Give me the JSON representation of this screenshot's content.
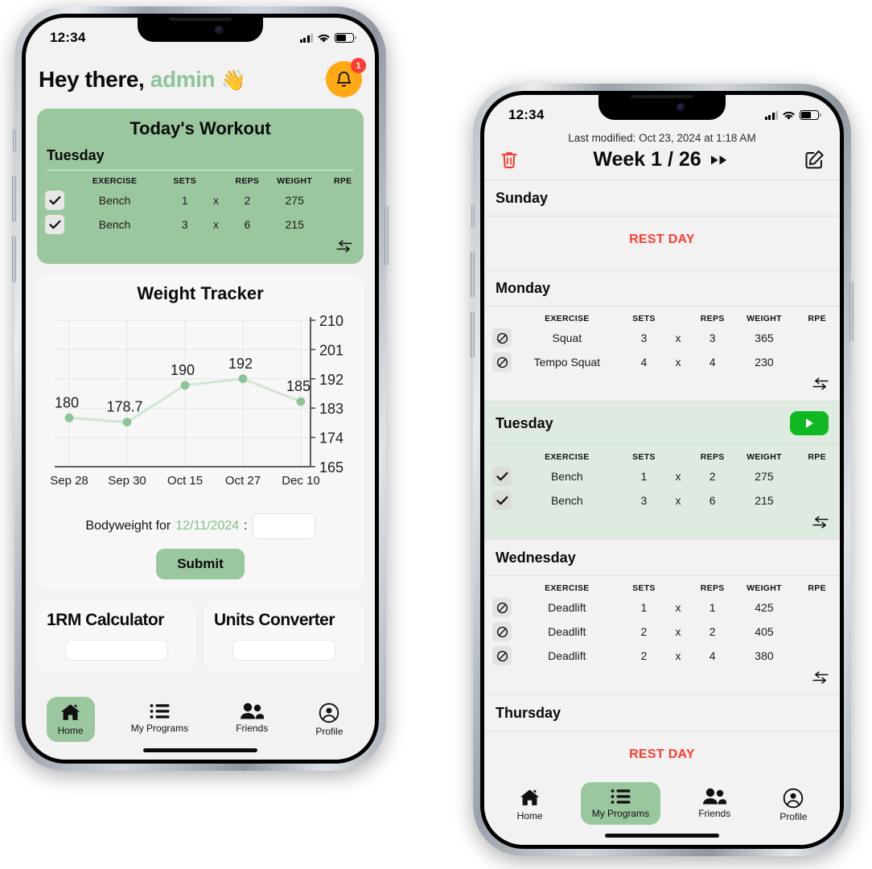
{
  "left_phone": {
    "status_bar": {
      "time": "12:34",
      "wifi_icon": "wifi-icon",
      "battery_icon": "battery-icon",
      "signal_icon": "cellular-signal-icon"
    },
    "header": {
      "greeting_prefix": "Hey there,",
      "username": "admin",
      "wave_emoji": "👋",
      "bell_icon": "notification-bell-icon",
      "notification_count": "1"
    },
    "today_card": {
      "title": "Today's Workout",
      "day": "Tuesday",
      "columns": [
        "EXERCISE",
        "SETS",
        "REPS",
        "WEIGHT",
        "RPE"
      ],
      "multiplier": "x",
      "rows": [
        {
          "checked": true,
          "exercise": "Bench",
          "sets": "1",
          "reps": "2",
          "weight": "275",
          "rpe": ""
        },
        {
          "checked": true,
          "exercise": "Bench",
          "sets": "3",
          "reps": "6",
          "weight": "215",
          "rpe": ""
        }
      ],
      "swap_icon": "swap-arrows-icon"
    },
    "tracker_card": {
      "title": "Weight Tracker",
      "bodyweight_label_prefix": "Bodyweight for",
      "bodyweight_date": "12/11/2024",
      "bodyweight_label_suffix": ":",
      "bodyweight_value": "",
      "bodyweight_placeholder": "",
      "submit_label": "Submit"
    },
    "tools": [
      {
        "title": "1RM Calculator"
      },
      {
        "title": "Units Converter"
      }
    ],
    "tabbar": {
      "active": "Home",
      "items": [
        {
          "label": "Home",
          "icon": "home-icon"
        },
        {
          "label": "My Programs",
          "icon": "list-icon"
        },
        {
          "label": "Friends",
          "icon": "people-icon"
        },
        {
          "label": "Profile",
          "icon": "person-circle-icon"
        }
      ]
    }
  },
  "right_phone": {
    "status_bar": {
      "time": "12:34",
      "wifi_icon": "wifi-icon",
      "battery_icon": "battery-icon",
      "signal_icon": "cellular-signal-icon"
    },
    "header": {
      "last_modified": "Last modified: Oct 23, 2024 at 1:18 AM",
      "title": "Week 1 / 26",
      "delete_icon": "trash-icon",
      "next_icon": "fast-forward-icon",
      "edit_icon": "edit-square-icon"
    },
    "columns": [
      "EXERCISE",
      "SETS",
      "REPS",
      "WEIGHT",
      "RPE"
    ],
    "multiplier": "x",
    "rest_day_label": "REST DAY",
    "swap_icon": "swap-arrows-icon",
    "days": [
      {
        "name": "Sunday",
        "rest": true,
        "highlight": false,
        "rows": []
      },
      {
        "name": "Monday",
        "rest": false,
        "highlight": false,
        "rows": [
          {
            "state": "blocked",
            "exercise": "Squat",
            "sets": "3",
            "reps": "3",
            "weight": "365",
            "rpe": ""
          },
          {
            "state": "blocked",
            "exercise": "Tempo Squat",
            "sets": "4",
            "reps": "4",
            "weight": "230",
            "rpe": ""
          }
        ]
      },
      {
        "name": "Tuesday",
        "rest": false,
        "highlight": true,
        "play_icon": "play-icon",
        "rows": [
          {
            "state": "checked",
            "exercise": "Bench",
            "sets": "1",
            "reps": "2",
            "weight": "275",
            "rpe": ""
          },
          {
            "state": "checked",
            "exercise": "Bench",
            "sets": "3",
            "reps": "6",
            "weight": "215",
            "rpe": ""
          }
        ]
      },
      {
        "name": "Wednesday",
        "rest": false,
        "highlight": false,
        "rows": [
          {
            "state": "blocked",
            "exercise": "Deadlift",
            "sets": "1",
            "reps": "1",
            "weight": "425",
            "rpe": ""
          },
          {
            "state": "blocked",
            "exercise": "Deadlift",
            "sets": "2",
            "reps": "2",
            "weight": "405",
            "rpe": ""
          },
          {
            "state": "blocked",
            "exercise": "Deadlift",
            "sets": "2",
            "reps": "4",
            "weight": "380",
            "rpe": ""
          }
        ]
      },
      {
        "name": "Thursday",
        "rest": true,
        "highlight": false,
        "rows": []
      }
    ],
    "tabbar": {
      "active": "My Programs",
      "items": [
        {
          "label": "Home",
          "icon": "home-icon"
        },
        {
          "label": "My Programs",
          "icon": "list-icon"
        },
        {
          "label": "Friends",
          "icon": "people-icon"
        },
        {
          "label": "Profile",
          "icon": "person-circle-icon"
        }
      ]
    }
  },
  "colors": {
    "brand_green": "#9BC79F",
    "light_green_section": "#DFEBE0",
    "username_green": "#8FC49A",
    "rest_day_red": "#FF3B30",
    "play_green": "#10B921",
    "bell_orange": "#FFA914",
    "chart_line": "#CFE6D2",
    "chart_point": "#8FC49A",
    "screen_bg": "#F2F2F2",
    "card_bg": "#F7F7F7"
  },
  "chart_data": {
    "type": "line",
    "title": "Weight Tracker",
    "x": [
      "Sep 28",
      "Sep 30",
      "Oct 15",
      "Oct 27",
      "Dec 10"
    ],
    "values": [
      180,
      178.7,
      190,
      192,
      185
    ],
    "point_labels": [
      "180",
      "178.7",
      "190",
      "192",
      "185"
    ],
    "yticks": [
      165,
      174,
      183,
      192,
      201,
      210
    ],
    "ylim": [
      165,
      210
    ],
    "xlabel": "",
    "ylabel": "",
    "grid": true,
    "y_axis_position": "right",
    "legend": "none"
  }
}
